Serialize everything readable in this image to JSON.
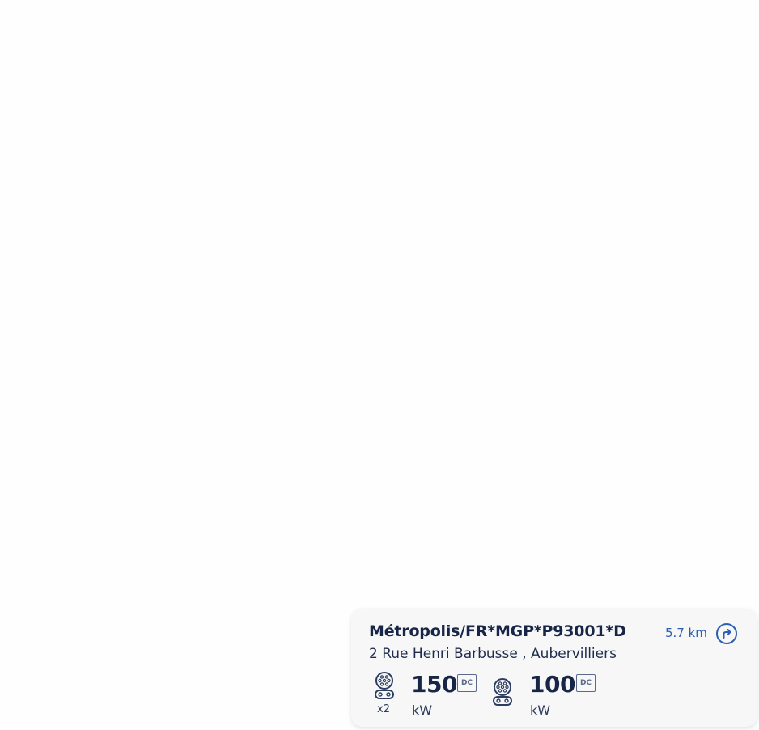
{
  "station": {
    "name": "Métropolis/FR*MGP*P93001*D",
    "address": "2 Rue Henri Barbusse , Aubervilliers",
    "distance": "5.7 km",
    "connectors": [
      {
        "icon": "ccs-plug-icon",
        "count": "x2",
        "power": "150",
        "current": "DC",
        "unit": "kW"
      },
      {
        "icon": "ccs-plug-icon",
        "count": "",
        "power": "100",
        "current": "DC",
        "unit": "kW"
      }
    ]
  },
  "colors": {
    "title": "#172647",
    "distance": "#2d5fb0",
    "card_bg": "#f7f7f8"
  }
}
